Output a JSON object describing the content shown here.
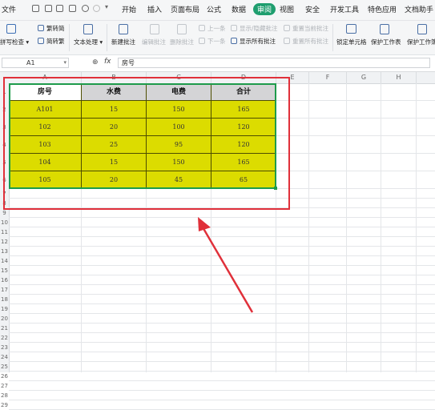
{
  "menubar": {
    "file_label": "文件",
    "tabs": [
      "开始",
      "插入",
      "页面布局",
      "公式",
      "数据",
      "审阅",
      "视图",
      "安全",
      "开发工具",
      "特色应用",
      "文档助手"
    ],
    "active_tab": "审阅"
  },
  "ribbon": {
    "spell_check": "拼写检查",
    "to_simplified": "繁转简",
    "to_traditional": "简转繁",
    "text_process": "文本处理",
    "new_comment": "新建批注",
    "edit_comment": "编辑批注",
    "delete_comment": "删除批注",
    "prev": "上一条",
    "next": "下一条",
    "show_hide_comment": "显示/隐藏批注",
    "show_all_comments": "显示所有批注",
    "reset_current_comment": "重置当前批注",
    "reset_all_comments": "重置所有批注",
    "lock_cell": "锁定单元格",
    "protect_sheet": "保护工作表",
    "protect_workbook": "保护工作簿"
  },
  "formula_bar": {
    "cell_ref": "A1",
    "fx_label": "fx",
    "content": "房号"
  },
  "grid": {
    "columns": [
      "A",
      "B",
      "C",
      "D",
      "E",
      "F",
      "G",
      "H"
    ],
    "rows": [
      "1",
      "2",
      "3",
      "4",
      "5",
      "6",
      "7",
      "8",
      "9",
      "10",
      "11",
      "12",
      "13",
      "14",
      "15",
      "16",
      "17",
      "18",
      "19",
      "20",
      "21",
      "22",
      "23",
      "24",
      "25",
      "26",
      "27",
      "28",
      "29"
    ]
  },
  "table": {
    "headers": [
      "房号",
      "水费",
      "电费",
      "合计"
    ],
    "rows": [
      [
        "A101",
        "15",
        "150",
        "165"
      ],
      [
        "102",
        "20",
        "100",
        "120"
      ],
      [
        "103",
        "25",
        "95",
        "120"
      ],
      [
        "104",
        "15",
        "150",
        "165"
      ],
      [
        "105",
        "20",
        "45",
        "65"
      ]
    ]
  },
  "colors": {
    "data_fill": "#dcdc00",
    "header_fill": "#d4d4d6",
    "selection": "#1e9b4b",
    "annotation": "#e0303a",
    "active_tab": "#1f9e6f"
  }
}
